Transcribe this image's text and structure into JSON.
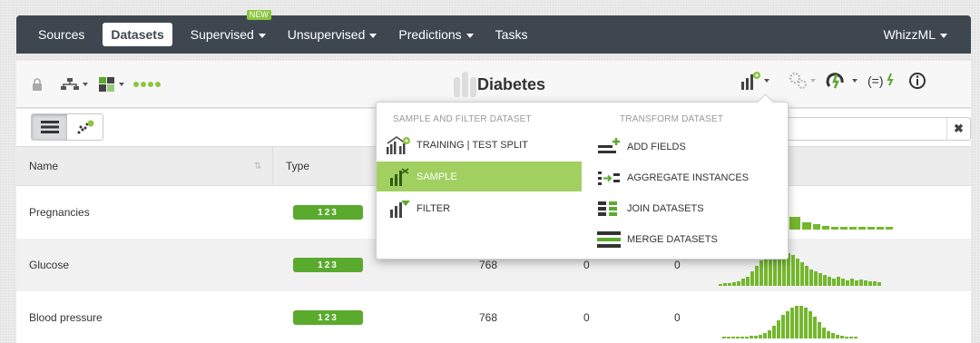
{
  "nav": {
    "items": [
      {
        "label": "Sources",
        "active": false,
        "caret": false
      },
      {
        "label": "Datasets",
        "active": true,
        "caret": false
      },
      {
        "label": "Supervised",
        "active": false,
        "caret": true
      },
      {
        "label": "Unsupervised",
        "active": false,
        "caret": true
      },
      {
        "label": "Predictions",
        "active": false,
        "caret": true
      },
      {
        "label": "Tasks",
        "active": false,
        "caret": false
      }
    ],
    "new_badge": "NEW",
    "right_label": "WhizzML"
  },
  "toolbar": {
    "title": "Diabetes"
  },
  "table": {
    "headers": {
      "name": "Name",
      "type": "Type"
    },
    "rows": [
      {
        "name": "Pregnancies",
        "type": "123",
        "count": "",
        "missing": "",
        "errors": ""
      },
      {
        "name": "Glucose",
        "type": "123",
        "count": "768",
        "missing": "0",
        "errors": "0"
      },
      {
        "name": "Blood pressure",
        "type": "123",
        "count": "768",
        "missing": "0",
        "errors": "0"
      }
    ]
  },
  "dropdown": {
    "left_heading": "SAMPLE AND FILTER DATASET",
    "right_heading": "TRANSFORM DATASET",
    "left_items": [
      {
        "label": "TRAINING | TEST SPLIT",
        "icon": "training-test-split-icon",
        "highlighted": false
      },
      {
        "label": "SAMPLE",
        "icon": "sample-icon",
        "highlighted": true
      },
      {
        "label": "FILTER",
        "icon": "filter-icon",
        "highlighted": false
      }
    ],
    "right_items": [
      {
        "label": "ADD FIELDS",
        "icon": "add-fields-icon"
      },
      {
        "label": "AGGREGATE INSTANCES",
        "icon": "aggregate-instances-icon"
      },
      {
        "label": "JOIN DATASETS",
        "icon": "join-datasets-icon"
      },
      {
        "label": "MERGE DATASETS",
        "icon": "merge-datasets-icon"
      }
    ]
  },
  "colors": {
    "nav_bg": "#3e474f",
    "accent_green": "#5aaa2e",
    "highlight_green": "#a2d060",
    "hist_green": "#74b72e"
  }
}
